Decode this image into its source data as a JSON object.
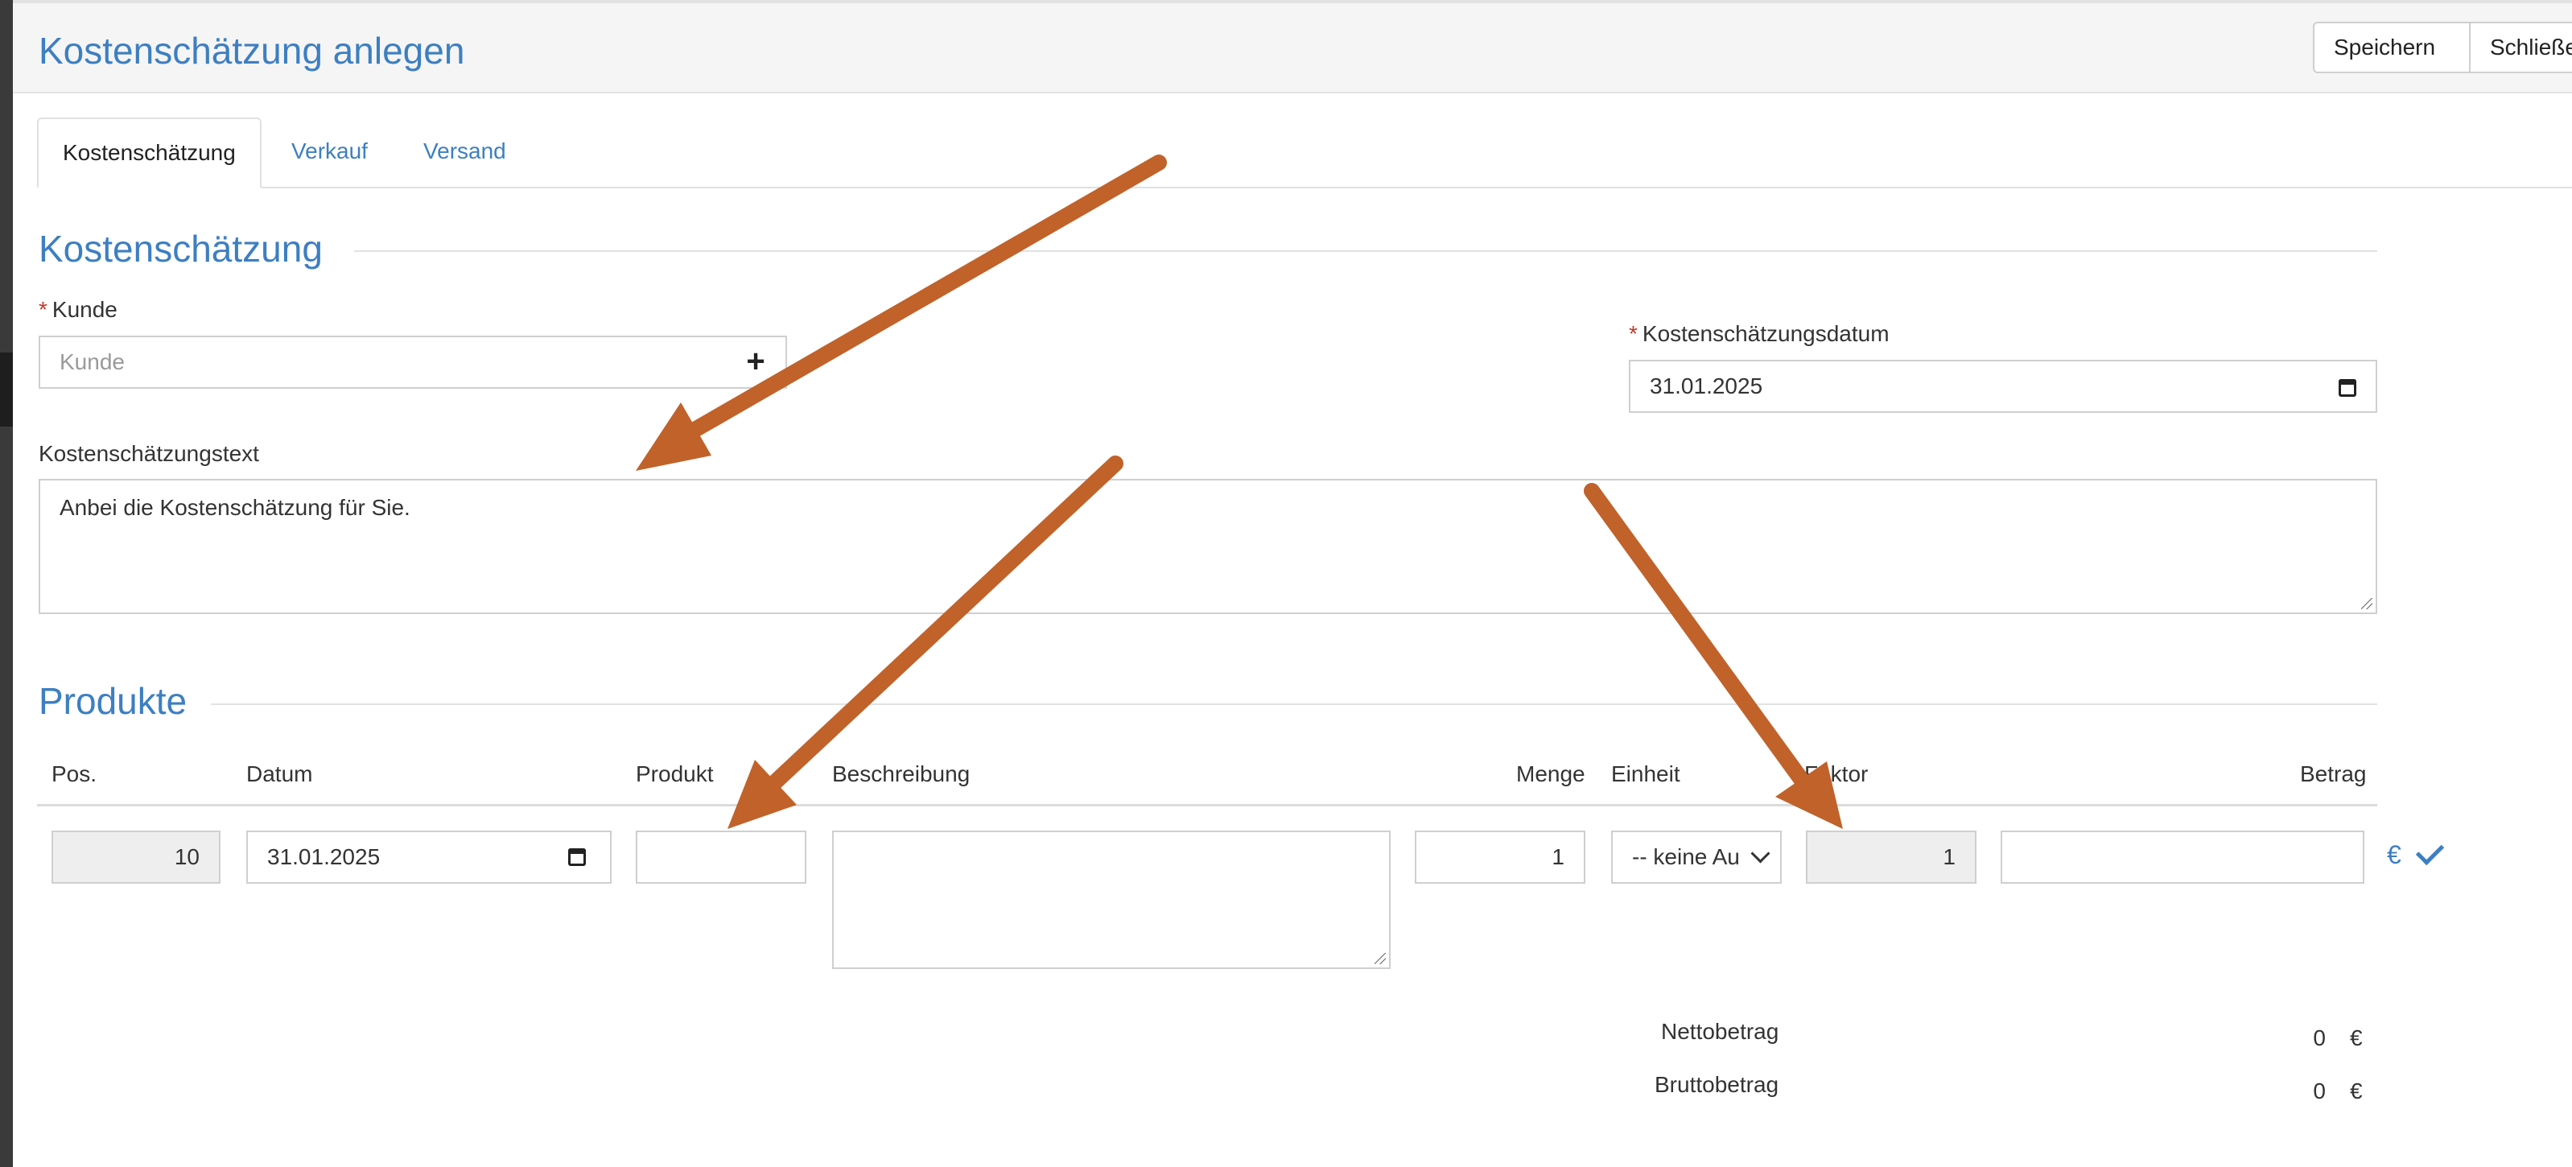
{
  "header": {
    "title": "Kostenschätzung anlegen",
    "save_label": "Speichern",
    "close_label": "Schließen"
  },
  "tabs": [
    {
      "label": "Kostenschätzung",
      "active": true
    },
    {
      "label": "Verkauf",
      "active": false
    },
    {
      "label": "Versand",
      "active": false
    }
  ],
  "section_estimate": {
    "title": "Kostenschätzung",
    "customer_label": "Kunde",
    "customer_placeholder": "Kunde",
    "add_symbol": "+",
    "date_label": "Kostenschätzungsdatum",
    "date_value": "31.01.2025",
    "text_label": "Kostenschätzungstext",
    "text_value": "Anbei die Kostenschätzung für Sie.",
    "required_marker": "*"
  },
  "section_products": {
    "title": "Produkte",
    "columns": [
      "Pos.",
      "Datum",
      "Produkt",
      "Beschreibung",
      "Menge",
      "Einheit",
      "Faktor",
      "Betrag"
    ],
    "row": {
      "pos": "10",
      "date": "31.01.2025",
      "product": "",
      "description": "",
      "quantity": "1",
      "unit": "-- keine Au",
      "factor": "1",
      "amount": "",
      "currency_symbol": "€"
    },
    "totals": {
      "net_label": "Nettobetrag",
      "net_value": "0",
      "gross_label": "Bruttobetrag",
      "gross_value": "0",
      "currency": "€"
    }
  },
  "annotations": {
    "arrow_color": "#c0622a"
  }
}
